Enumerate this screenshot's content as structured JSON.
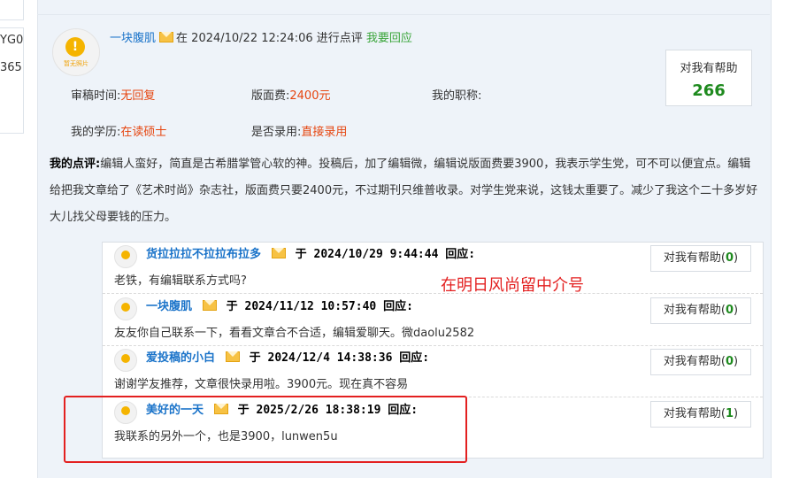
{
  "left_fragment": {
    "line1": "YG0",
    "line2": "365"
  },
  "review": {
    "user": "一块腹肌",
    "connector": "在",
    "timestamp": "2024/10/22 12:24:06",
    "action": "进行点评",
    "respond_link": "我要回应",
    "avatar_caption": "暂无照片",
    "helpful_label": "对我有帮助",
    "helpful_count": "266",
    "fields": {
      "review_time_label": "审稿时间:",
      "review_time_value": "无回复",
      "fee_label": "版面费:",
      "fee_value": "2400元",
      "title_label": "我的职称:",
      "title_value": "",
      "edu_label": "我的学历:",
      "edu_value": "在读硕士",
      "accepted_label": "是否录用:",
      "accepted_value": "直接录用"
    },
    "comment_label": "我的点评:",
    "comment_text": "编辑人蛮好，简直是古希腊掌管心软的神。投稿后，加了编辑微，编辑说版面费要3900，我表示学生党，可不可以便宜点。编辑给把我文章给了《艺术时尚》杂志社，版面费只要2400元，不过期刊只维普收录。对学生党来说，这钱太重要了。减少了我这个二十多岁好大儿找父母要钱的压力。"
  },
  "replies": [
    {
      "user": "货拉拉拉不拉拉布拉多",
      "prefix": "于",
      "timestamp": "2024/10/29 9:44:44",
      "suffix": "回应:",
      "text": "老铁，有编辑联系方式吗?",
      "helpful_label": "对我有帮助",
      "count": "0"
    },
    {
      "user": "一块腹肌",
      "prefix": "于",
      "timestamp": "2024/11/12 10:57:40",
      "suffix": "回应:",
      "text": "友友你自己联系一下，看看文章合不合适，编辑爱聊天。微daolu2582",
      "helpful_label": "对我有帮助",
      "count": "0"
    },
    {
      "user": "爱投稿的小白",
      "prefix": "于",
      "timestamp": "2024/12/4 14:38:36",
      "suffix": "回应:",
      "text": "谢谢学友推荐，文章很快录用啦。3900元。现在真不容易",
      "helpful_label": "对我有帮助",
      "count": "0"
    },
    {
      "user": "美好的一天",
      "prefix": "于",
      "timestamp": "2025/2/26 18:38:19",
      "suffix": "回应:",
      "text": "我联系的另外一个，也是3900，lunwen5u",
      "helpful_label": "对我有帮助",
      "count": "1"
    }
  ],
  "annotation": "在明日风尚留中介号",
  "colors": {
    "link": "#1a73c9",
    "value_red": "#e6450f",
    "green": "#3aa53a",
    "count_green": "#1e8a1e",
    "annotation_red": "#e32020"
  }
}
